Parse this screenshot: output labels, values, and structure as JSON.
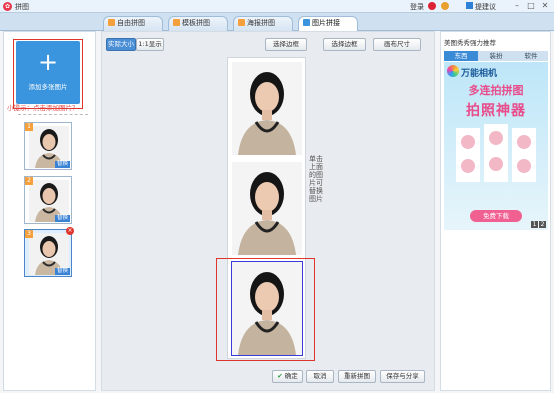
{
  "app": {
    "title": "拼图",
    "login": "登录",
    "help": "提建议"
  },
  "tabs": [
    {
      "label": "自由拼图",
      "active": false
    },
    {
      "label": "模板拼图",
      "active": false
    },
    {
      "label": "海报拼图",
      "active": false
    },
    {
      "label": "图片拼接",
      "active": true
    }
  ],
  "left": {
    "add_label": "添加多张图片",
    "hint": "小提示：点击添加图片？",
    "thumbs": [
      {
        "num": "1",
        "replace": "替换"
      },
      {
        "num": "2",
        "replace": "替换"
      },
      {
        "num": "3",
        "replace": "替换"
      }
    ]
  },
  "toolbar": {
    "zoom_fit": "实际大小",
    "zoom_max": "1:1显示",
    "border": "选择边框",
    "bg": "选择边框",
    "size": "画布尺寸"
  },
  "canvas": {
    "vertical_note": "单击上面的图片可替换图片"
  },
  "bottom": {
    "confirm": "确定",
    "cancel": "取消",
    "reset": "重新拼图",
    "save": "保存与分享"
  },
  "right": {
    "title": "美图秀秀强力推荐",
    "tabs": [
      "东西",
      "装扮",
      "软件"
    ],
    "ad": {
      "brand": "万能相机",
      "line1": "多连拍拼图",
      "line2": "拍照神器",
      "download": "免费下载",
      "pages": [
        "1",
        "2"
      ]
    }
  },
  "colors": {
    "accent": "#3a95de",
    "highlight": "#e0352b",
    "selection": "#3a3ad8"
  }
}
